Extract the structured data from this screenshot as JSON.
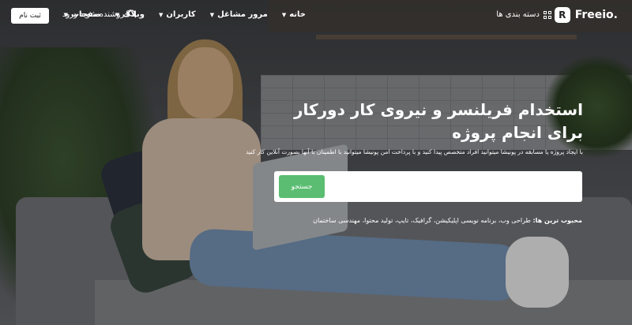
{
  "header": {
    "logo_text": "Freeio.",
    "categories_label": "دسته بندی ها",
    "nav": [
      {
        "label": "خانه"
      },
      {
        "label": "مرور مشاغل"
      },
      {
        "label": "کاربران"
      },
      {
        "label": "وبلاگ"
      },
      {
        "label": "صفحات"
      }
    ],
    "seller_label": "فروشنده شوید",
    "login_label": "ورود",
    "signup_label": "ثبت نام"
  },
  "hero": {
    "title_line1": "استخدام فریلنسر و نیروی کار دورکار",
    "title_line2": "برای انجام پروژه",
    "subtitle": "با ایجاد پروژه یا مسابقه در پونیشا میتوانید افراد متخصص پیدا کنید و با پرداخت امن پونیشا میتوانید با اطمینان با آنها بصورت آنلاین کار کنید",
    "search_button": "جستجو",
    "search_placeholder": "",
    "popular_label": "محبوب ترین ها:",
    "popular_items": "طراحی وب، برنامه نویسی اپلیکیشن، گرافیک، تایپ، تولید محتوا، مهندسی ساختمان"
  },
  "colors": {
    "accent": "#5bbd72",
    "header_text": "#ffffff"
  }
}
